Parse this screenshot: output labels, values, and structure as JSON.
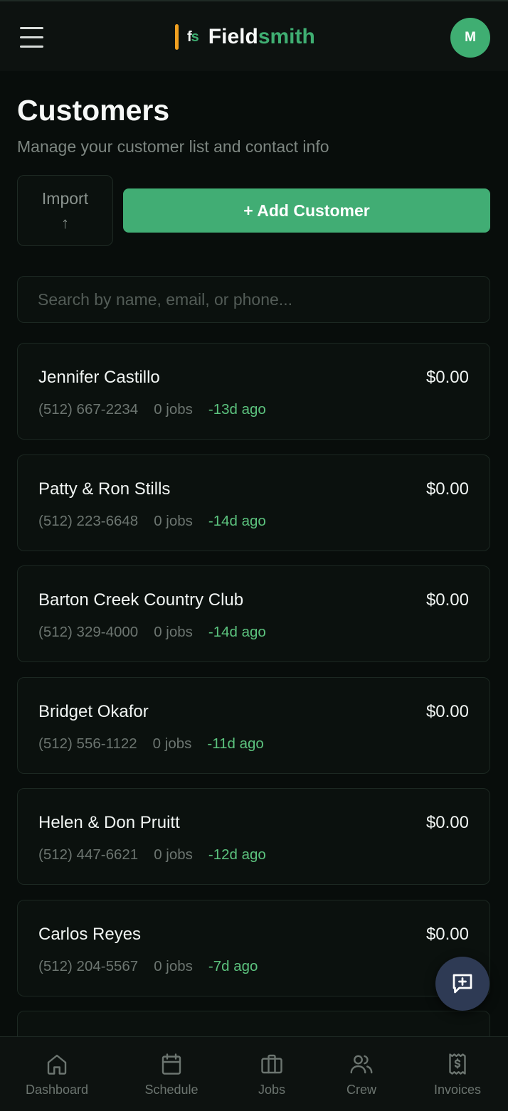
{
  "header": {
    "logo_mark_f": "f",
    "logo_mark_s": "s",
    "app_name_part1": "Field",
    "app_name_part2": "smith",
    "avatar_initial": "M"
  },
  "page": {
    "title": "Customers",
    "subtitle": "Manage your customer list and contact info",
    "import_label": "Import",
    "import_arrow": "↑",
    "add_label": "+ Add Customer",
    "search_placeholder": "Search by name, email, or phone..."
  },
  "customers": [
    {
      "name": "Jennifer Castillo",
      "amount": "$0.00",
      "phone": "(512) 667-2234",
      "jobs": "0 jobs",
      "ago": "-13d ago"
    },
    {
      "name": "Patty & Ron Stills",
      "amount": "$0.00",
      "phone": "(512) 223-6648",
      "jobs": "0 jobs",
      "ago": "-14d ago"
    },
    {
      "name": "Barton Creek Country Club",
      "amount": "$0.00",
      "phone": "(512) 329-4000",
      "jobs": "0 jobs",
      "ago": "-14d ago"
    },
    {
      "name": "Bridget Okafor",
      "amount": "$0.00",
      "phone": "(512) 556-1122",
      "jobs": "0 jobs",
      "ago": "-11d ago"
    },
    {
      "name": "Helen & Don Pruitt",
      "amount": "$0.00",
      "phone": "(512) 447-6621",
      "jobs": "0 jobs",
      "ago": "-12d ago"
    },
    {
      "name": "Carlos Reyes",
      "amount": "$0.00",
      "phone": "(512) 204-5567",
      "jobs": "0 jobs",
      "ago": "-7d ago"
    },
    {
      "name": "",
      "amount": "",
      "phone": "",
      "jobs": "",
      "ago": ""
    }
  ],
  "nav": [
    {
      "label": "Dashboard",
      "icon": "home-icon"
    },
    {
      "label": "Schedule",
      "icon": "calendar-icon"
    },
    {
      "label": "Jobs",
      "icon": "briefcase-icon"
    },
    {
      "label": "Crew",
      "icon": "users-icon"
    },
    {
      "label": "Invoices",
      "icon": "receipt-icon"
    }
  ],
  "colors": {
    "accent": "#41ad74",
    "logo_bar": "#f0a020",
    "recent_text": "#5cc37e",
    "fab_bg": "#2e3a54"
  }
}
